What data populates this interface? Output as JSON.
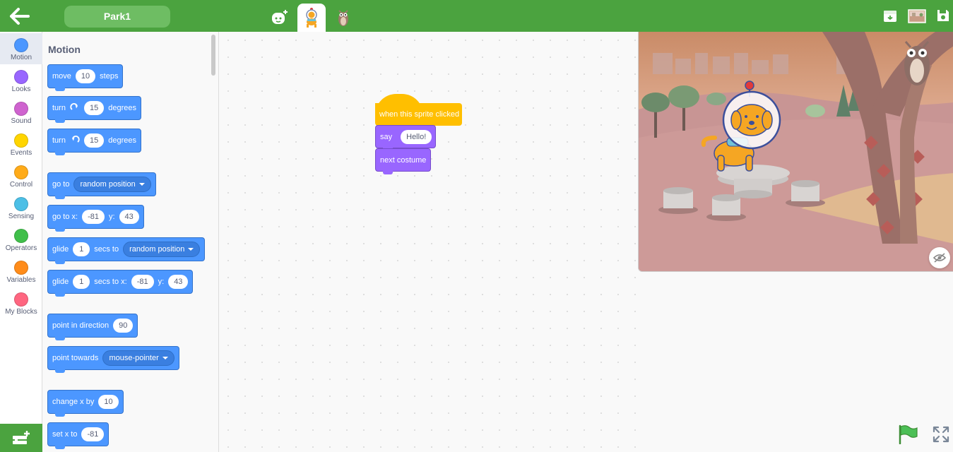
{
  "project": {
    "name": "Park1"
  },
  "colors": {
    "topbar": "#4ba33f",
    "motion": "#4c97ff",
    "looks": "#9966ff",
    "events": "#ffbf00"
  },
  "topbar": {
    "back_icon": "back-arrow-icon",
    "sprite_tabs": [
      {
        "icon": "add-sprite-icon"
      },
      {
        "icon": "dog-sprite-icon",
        "selected": true
      },
      {
        "icon": "owl-sprite-icon"
      }
    ],
    "right_icons": [
      "download-icon",
      "backdrop-icon",
      "save-icon"
    ]
  },
  "categories": [
    {
      "label": "Motion",
      "color": "#4c97ff",
      "active": true
    },
    {
      "label": "Looks",
      "color": "#9966ff"
    },
    {
      "label": "Sound",
      "color": "#cf63cf"
    },
    {
      "label": "Events",
      "color": "#ffd500"
    },
    {
      "label": "Control",
      "color": "#ffab19"
    },
    {
      "label": "Sensing",
      "color": "#4cbfe6"
    },
    {
      "label": "Operators",
      "color": "#40bf4a"
    },
    {
      "label": "Variables",
      "color": "#ff8c1a"
    },
    {
      "label": "My Blocks",
      "color": "#ff6680"
    }
  ],
  "palette": {
    "heading": "Motion",
    "move": {
      "t1": "move",
      "v1": "10",
      "t2": "steps"
    },
    "turn_right": {
      "t1": "turn",
      "v1": "15",
      "t2": "degrees"
    },
    "turn_left": {
      "t1": "turn",
      "v1": "15",
      "t2": "degrees"
    },
    "go_to": {
      "t1": "go to",
      "dd": "random position"
    },
    "go_to_xy": {
      "t1": "go to x:",
      "v1": "-81",
      "t2": "y:",
      "v2": "43"
    },
    "glide_to": {
      "t1": "glide",
      "v1": "1",
      "t2": "secs to",
      "dd": "random position"
    },
    "glide_xy": {
      "t1": "glide",
      "v1": "1",
      "t2": "secs to x:",
      "v2": "-81",
      "t3": "y:",
      "v3": "43"
    },
    "point_dir": {
      "t1": "point in direction",
      "v1": "90"
    },
    "point_towards": {
      "t1": "point towards",
      "dd": "mouse-pointer"
    },
    "change_x": {
      "t1": "change x by",
      "v1": "10"
    },
    "set_x": {
      "t1": "set x to",
      "v1": "-81"
    }
  },
  "script": {
    "hat": "when this sprite clicked",
    "say": {
      "t1": "say",
      "v1": "Hello!"
    },
    "next": "next costume"
  },
  "stage": {
    "hide_icon": "eye-hidden-icon"
  },
  "controls": {
    "flag_icon": "green-flag-icon",
    "fullscreen_icon": "fullscreen-icon"
  }
}
